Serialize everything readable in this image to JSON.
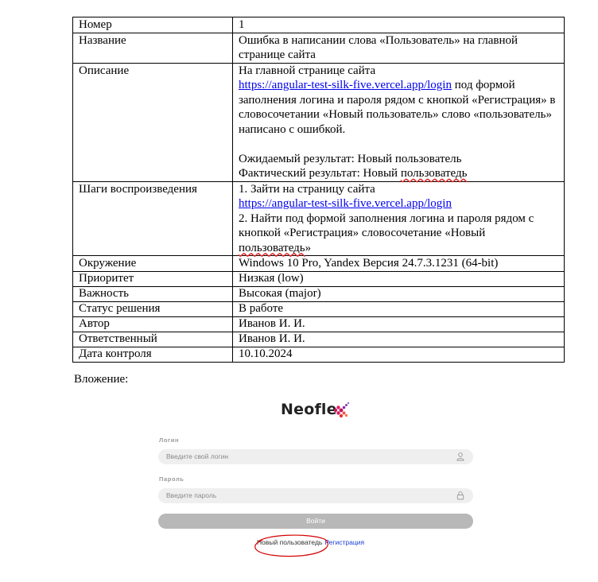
{
  "table": {
    "number_label": "Номер",
    "number_value": "1",
    "title_label": "Название",
    "title_value": "Ошибка в написании слова «Пользователь» на главной странице сайта",
    "description_label": "Описание",
    "description_line1": "На главной странице сайта",
    "description_link": "https://angular-test-silk-five.vercel.app/login",
    "description_line2": " под формой заполнения логина и пароля рядом с кнопкой «Регистрация» в словосочетании «Новый пользователь» слово «пользователь» написано с ошибкой.",
    "expected": "Ожидаемый результат: Новый пользователь",
    "actual_prefix": "Фактический результат: Новый ",
    "actual_misspelled": "пользоватедь",
    "steps_label": "Шаги воспроизведения",
    "step1_text": "1. Зайти на страницу сайта",
    "step1_link": "https://angular-test-silk-five.vercel.app/login",
    "step2_text": "2.  Найти под формой заполнения логина и пароля рядом с кнопкой «Регистрация» словосочетание «Новый ",
    "step2_misspelled": "пользоватедь",
    "step2_end": "»",
    "env_label": "Окружение",
    "env_value": "Windows 10 Pro, Yandex Версия 24.7.3.1231 (64-bit)",
    "priority_label": "Приоритет",
    "priority_value": "Низкая (low)",
    "severity_label": "Важность",
    "severity_value": "Высокая (major)",
    "status_label": "Статус решения",
    "status_value": "В работе",
    "author_label": "Автор",
    "author_value": "Иванов И. И.",
    "assignee_label": "Ответственный",
    "assignee_value": "Иванов И. И.",
    "date_label": "Дата контроля",
    "date_value": "10.10.2024"
  },
  "attachment_label": "Вложение:",
  "screenshot": {
    "logo_text": "Neofle",
    "login_label": "Логин",
    "login_placeholder": "Введите свой логин",
    "password_label": "Пароль",
    "password_placeholder": "Введите пароль",
    "login_button": "Войти",
    "new_user_text": "Новый пользоватедь",
    "register_link": "Регистрация",
    "colors": {
      "button": "#b8b8b8",
      "field": "#efefef",
      "link": "#1a3fd6",
      "highlight_circle": "#d40000",
      "logo_accent": "#c2185b"
    }
  }
}
